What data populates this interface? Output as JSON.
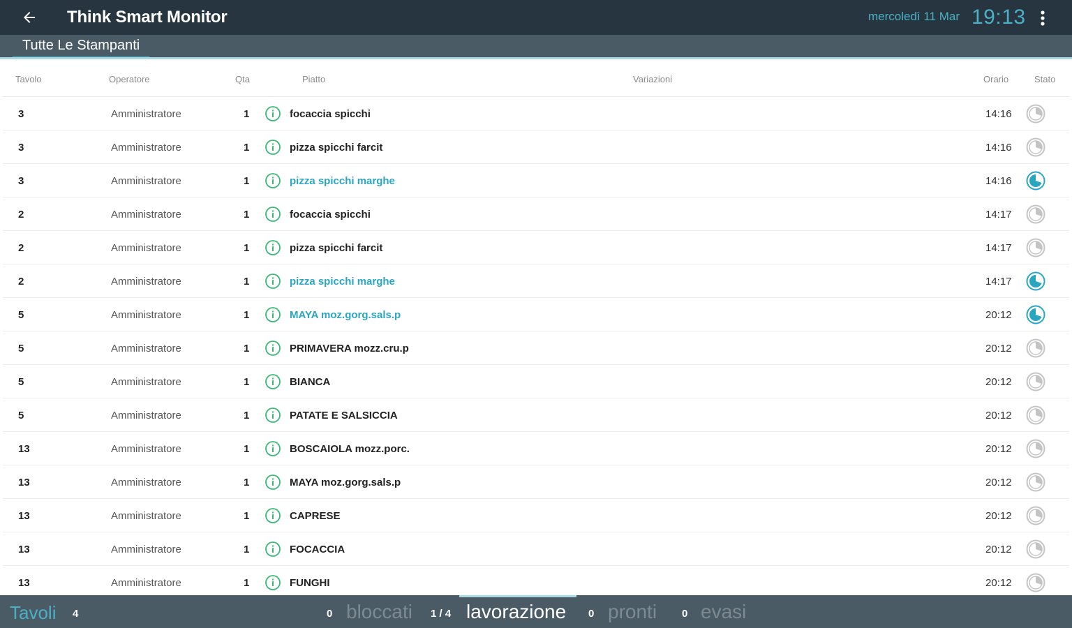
{
  "header": {
    "title": "Think Smart Monitor",
    "date": "mercoledì 11 Mar",
    "time": "19:13",
    "back_icon": "arrow-left-icon",
    "menu_icon": "more-vert-icon"
  },
  "subnav": {
    "tab_label": "Tutte Le Stampanti"
  },
  "table": {
    "headers": {
      "tavolo": "Tavolo",
      "operatore": "Operatore",
      "qta": "Qta",
      "piatto": "Piatto",
      "variazioni": "Variazioni",
      "orario": "Orario",
      "stato": "Stato"
    },
    "rows": [
      {
        "tavolo": "3",
        "operatore": "Amministratore",
        "qta": "1",
        "piatto": "focaccia spicchi",
        "orario": "14:16",
        "status": "pending"
      },
      {
        "tavolo": "3",
        "operatore": "Amministratore",
        "qta": "1",
        "piatto": "pizza spicchi farcit",
        "orario": "14:16",
        "status": "pending"
      },
      {
        "tavolo": "3",
        "operatore": "Amministratore",
        "qta": "1",
        "piatto": "pizza spicchi marghe",
        "orario": "14:16",
        "status": "active"
      },
      {
        "tavolo": "2",
        "operatore": "Amministratore",
        "qta": "1",
        "piatto": "focaccia spicchi",
        "orario": "14:17",
        "status": "pending"
      },
      {
        "tavolo": "2",
        "operatore": "Amministratore",
        "qta": "1",
        "piatto": "pizza spicchi farcit",
        "orario": "14:17",
        "status": "pending"
      },
      {
        "tavolo": "2",
        "operatore": "Amministratore",
        "qta": "1",
        "piatto": "pizza spicchi marghe",
        "orario": "14:17",
        "status": "active"
      },
      {
        "tavolo": "5",
        "operatore": "Amministratore",
        "qta": "1",
        "piatto": "MAYA moz.gorg.sals.p",
        "orario": "20:12",
        "status": "active"
      },
      {
        "tavolo": "5",
        "operatore": "Amministratore",
        "qta": "1",
        "piatto": "PRIMAVERA mozz.cru.p",
        "orario": "20:12",
        "status": "pending"
      },
      {
        "tavolo": "5",
        "operatore": "Amministratore",
        "qta": "1",
        "piatto": "BIANCA",
        "orario": "20:12",
        "status": "pending"
      },
      {
        "tavolo": "5",
        "operatore": "Amministratore",
        "qta": "1",
        "piatto": "PATATE E SALSICCIA",
        "orario": "20:12",
        "status": "pending"
      },
      {
        "tavolo": "13",
        "operatore": "Amministratore",
        "qta": "1",
        "piatto": "BOSCAIOLA mozz.porc.",
        "orario": "20:12",
        "status": "pending"
      },
      {
        "tavolo": "13",
        "operatore": "Amministratore",
        "qta": "1",
        "piatto": "MAYA moz.gorg.sals.p",
        "orario": "20:12",
        "status": "pending"
      },
      {
        "tavolo": "13",
        "operatore": "Amministratore",
        "qta": "1",
        "piatto": "CAPRESE",
        "orario": "20:12",
        "status": "pending"
      },
      {
        "tavolo": "13",
        "operatore": "Amministratore",
        "qta": "1",
        "piatto": "FOCACCIA",
        "orario": "20:12",
        "status": "pending"
      },
      {
        "tavolo": "13",
        "operatore": "Amministratore",
        "qta": "1",
        "piatto": "FUNGHI",
        "orario": "20:12",
        "status": "pending"
      }
    ]
  },
  "bottombar": {
    "tavoli_label": "Tavoli",
    "tavoli_count": "4",
    "bloccati_count": "0",
    "bloccati_label": "bloccati",
    "lavorazione_count": "1 / 4",
    "lavorazione_label": "lavorazione",
    "pronti_count": "0",
    "pronti_label": "pronti",
    "evasi_count": "0",
    "evasi_label": "evasi"
  },
  "colors": {
    "header_bg": "#26353f",
    "bar_bg": "#4b5b66",
    "accent": "#4bb0c6",
    "info_green": "#3cb878",
    "highlight_text": "#2aa6c1",
    "status_inactive": "#c4c4c4"
  }
}
